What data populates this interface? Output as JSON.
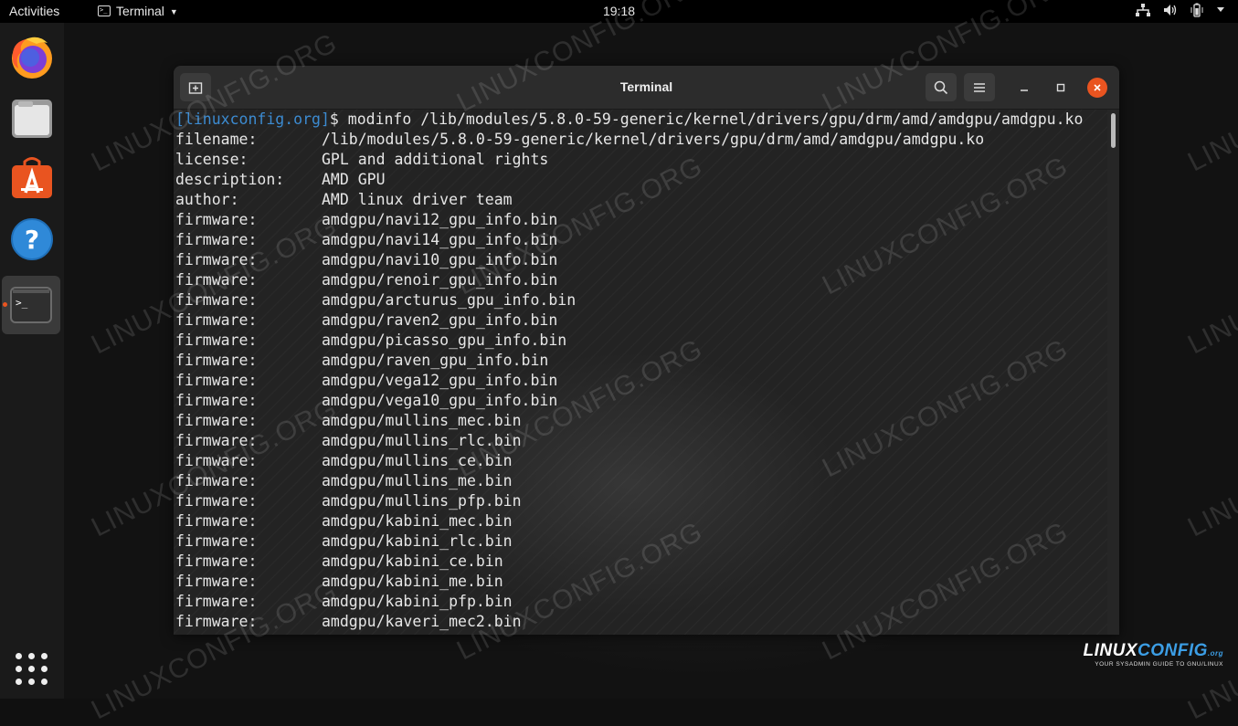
{
  "topbar": {
    "activities_label": "Activities",
    "app_menu_label": "Terminal",
    "clock": "19:18"
  },
  "window": {
    "title": "Terminal"
  },
  "terminal": {
    "prompt_host": "[linuxconfig.org]",
    "prompt_symbol": "$",
    "command": " modinfo /lib/modules/5.8.0-59-generic/kernel/drivers/gpu/drm/amd/amdgpu/amdgpu.ko",
    "lines": [
      {
        "key": "filename:",
        "value": "/lib/modules/5.8.0-59-generic/kernel/drivers/gpu/drm/amd/amdgpu/amdgpu.ko"
      },
      {
        "key": "license:",
        "value": "GPL and additional rights"
      },
      {
        "key": "description:",
        "value": "AMD GPU"
      },
      {
        "key": "author:",
        "value": "AMD linux driver team"
      },
      {
        "key": "firmware:",
        "value": "amdgpu/navi12_gpu_info.bin"
      },
      {
        "key": "firmware:",
        "value": "amdgpu/navi14_gpu_info.bin"
      },
      {
        "key": "firmware:",
        "value": "amdgpu/navi10_gpu_info.bin"
      },
      {
        "key": "firmware:",
        "value": "amdgpu/renoir_gpu_info.bin"
      },
      {
        "key": "firmware:",
        "value": "amdgpu/arcturus_gpu_info.bin"
      },
      {
        "key": "firmware:",
        "value": "amdgpu/raven2_gpu_info.bin"
      },
      {
        "key": "firmware:",
        "value": "amdgpu/picasso_gpu_info.bin"
      },
      {
        "key": "firmware:",
        "value": "amdgpu/raven_gpu_info.bin"
      },
      {
        "key": "firmware:",
        "value": "amdgpu/vega12_gpu_info.bin"
      },
      {
        "key": "firmware:",
        "value": "amdgpu/vega10_gpu_info.bin"
      },
      {
        "key": "firmware:",
        "value": "amdgpu/mullins_mec.bin"
      },
      {
        "key": "firmware:",
        "value": "amdgpu/mullins_rlc.bin"
      },
      {
        "key": "firmware:",
        "value": "amdgpu/mullins_ce.bin"
      },
      {
        "key": "firmware:",
        "value": "amdgpu/mullins_me.bin"
      },
      {
        "key": "firmware:",
        "value": "amdgpu/mullins_pfp.bin"
      },
      {
        "key": "firmware:",
        "value": "amdgpu/kabini_mec.bin"
      },
      {
        "key": "firmware:",
        "value": "amdgpu/kabini_rlc.bin"
      },
      {
        "key": "firmware:",
        "value": "amdgpu/kabini_ce.bin"
      },
      {
        "key": "firmware:",
        "value": "amdgpu/kabini_me.bin"
      },
      {
        "key": "firmware:",
        "value": "amdgpu/kabini_pfp.bin"
      },
      {
        "key": "firmware:",
        "value": "amdgpu/kaveri_mec2.bin"
      }
    ]
  },
  "dock": {
    "icons": [
      "firefox-icon",
      "files-icon",
      "software-center-icon",
      "help-icon",
      "terminal-icon",
      "show-applications-icon"
    ]
  },
  "watermark": "LINUXCONFIG.ORG",
  "logo": {
    "brand_a": "LINUX",
    "brand_b": "CONFIG",
    "brand_suffix": ".org",
    "tagline": "YOUR SYSADMIN GUIDE TO GNU/LINUX"
  },
  "colors": {
    "prompt_host": "#3c8bd1",
    "close_button": "#e95420",
    "accent_dot": "#e95420"
  }
}
